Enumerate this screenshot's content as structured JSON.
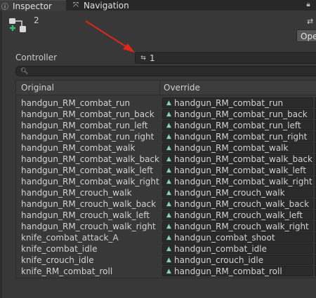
{
  "tabs": [
    {
      "label": "Inspector",
      "icon": "info-icon",
      "active": true
    },
    {
      "label": "Navigation",
      "icon": "navigation-icon",
      "active": false
    }
  ],
  "header": {
    "count": "2",
    "open_label": "Ope"
  },
  "controller": {
    "label": "Controller",
    "value": "1"
  },
  "table": {
    "col_original": "Original",
    "col_override": "Override",
    "rows": [
      {
        "original": "handgun_RM_combat_run",
        "override": "handgun_RM_combat_run"
      },
      {
        "original": "handgun_RM_combat_run_back",
        "override": "handgun_RM_combat_run_back"
      },
      {
        "original": "handgun_RM_combat_run_left",
        "override": "handgun_RM_combat_run_left"
      },
      {
        "original": "handgun_RM_combat_run_right",
        "override": "handgun_RM_combat_run_right"
      },
      {
        "original": "handgun_RM_combat_walk",
        "override": "handgun_RM_combat_walk"
      },
      {
        "original": "handgun_RM_combat_walk_back",
        "override": "handgun_RM_combat_walk_back"
      },
      {
        "original": "handgun_RM_combat_walk_left",
        "override": "handgun_RM_combat_walk_left"
      },
      {
        "original": "handgun_RM_combat_walk_right",
        "override": "handgun_RM_combat_walk_right"
      },
      {
        "original": "handgun_RM_crouch_walk",
        "override": "handgun_RM_crouch_walk"
      },
      {
        "original": "handgun_RM_crouch_walk_back",
        "override": "handgun_RM_crouch_walk_back"
      },
      {
        "original": "handgun_RM_crouch_walk_left",
        "override": "handgun_RM_crouch_walk_left"
      },
      {
        "original": "handgun_RM_crouch_walk_right",
        "override": "handgun_RM_crouch_walk_right"
      },
      {
        "original": "knife_combat_attack_A",
        "override": "handgun_combat_shoot"
      },
      {
        "original": "knife_combat_idle",
        "override": "handgun_combat_idle"
      },
      {
        "original": "knife_crouch_idle",
        "override": "handgun_crouch_idle"
      },
      {
        "original": "knife_RM_combat_roll",
        "override": "handgun_RM_combat_roll"
      }
    ]
  },
  "colors": {
    "annotation_arrow": "#e0261b",
    "clip_icon": "#7fd3c9"
  }
}
